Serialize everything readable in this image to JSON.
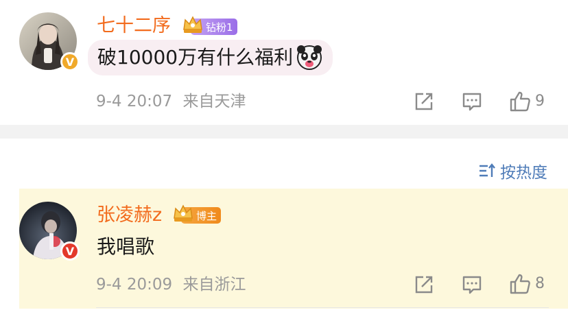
{
  "comments": [
    {
      "username": "七十二序",
      "badge_label": "钻粉1",
      "text": "破10000万有什么福利",
      "emoji": "panda-tongue-emoji",
      "time": "9-4 20:07",
      "location": "来自天津",
      "like_count": "9",
      "verified_color": "#f0a92a"
    },
    {
      "username": "张凌赫z",
      "badge_label": "博主",
      "text": "我唱歌",
      "time": "9-4 20:09",
      "location": "来自浙江",
      "like_count": "8",
      "verified_color": "#e3392b"
    }
  ],
  "sort": {
    "label": "按热度"
  },
  "colors": {
    "username": "#f26b1d",
    "meta": "#9a9a9a",
    "sort": "#4f7cb8",
    "highlight_bg": "#fdf8dc",
    "bubble_bg": "#f8eef2"
  },
  "icons": [
    "verified-icon",
    "crown-icon",
    "forward-icon",
    "reply-icon",
    "like-icon",
    "sort-icon"
  ]
}
